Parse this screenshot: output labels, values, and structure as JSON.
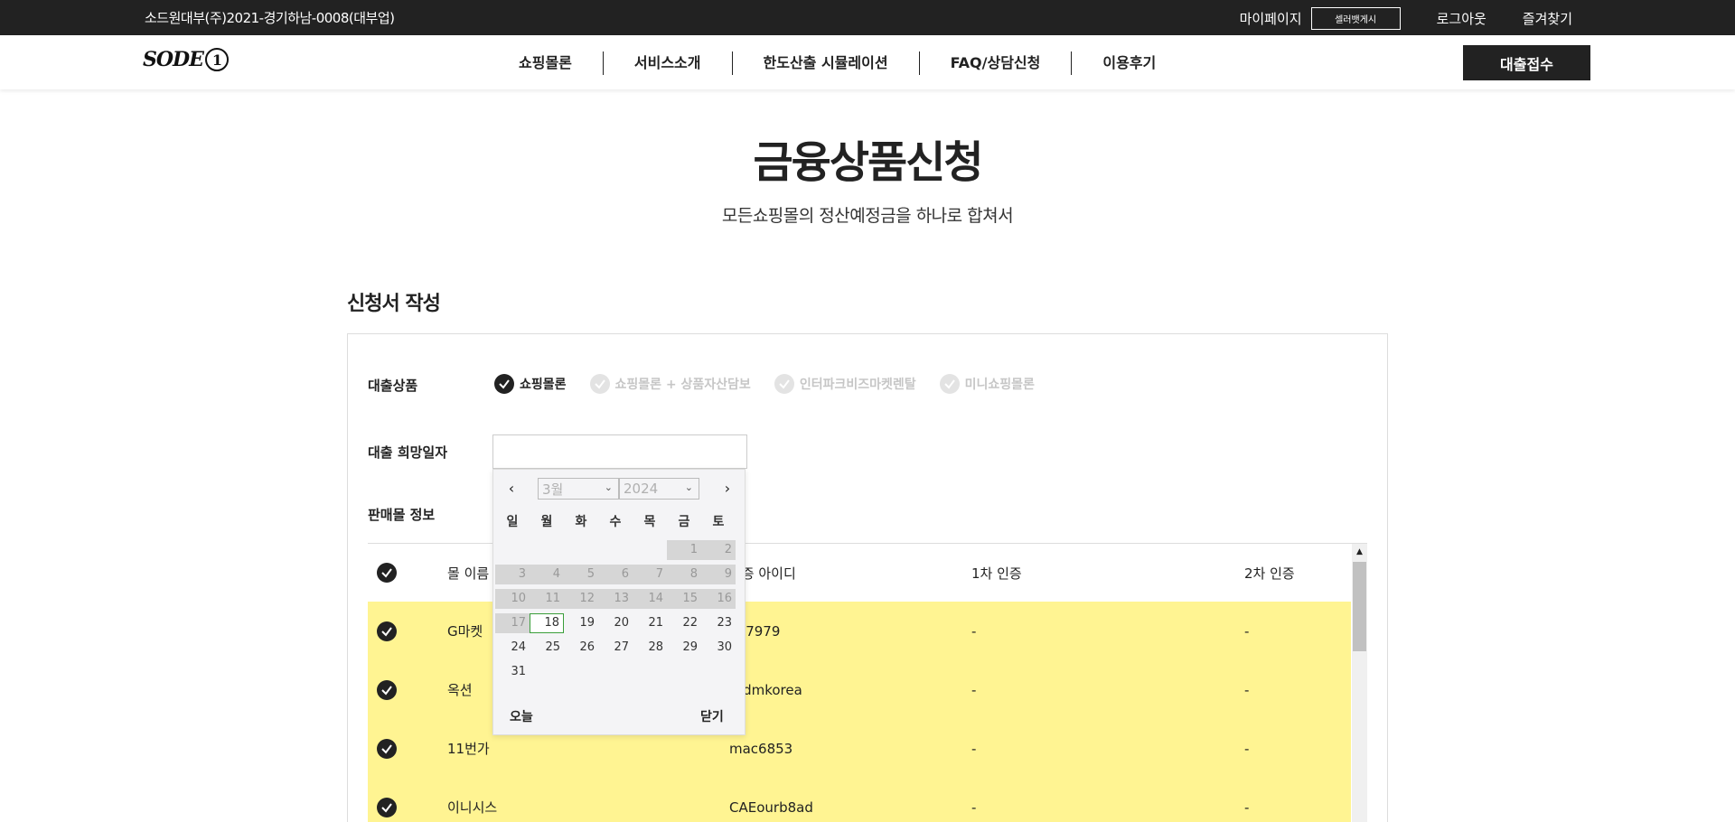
{
  "topbar": {
    "company": "소드원대부(주)2021-경기하남-0008(대부업)",
    "mypage": "마이페이지",
    "seller_button": "셀러뱃게시",
    "logout": "로그아웃",
    "bookmark": "즐겨찾기"
  },
  "header": {
    "logo_text": "SODE",
    "logo_num": "1",
    "nav": [
      "쇼핑몰론",
      "서비스소개",
      "한도산출 시뮬레이션",
      "FAQ/상담신청",
      "이용후기"
    ],
    "apply_button": "대출접수"
  },
  "hero": {
    "title": "금융상품신청",
    "subtitle": "모든쇼핑몰의 정산예정금을 하나로 합쳐서"
  },
  "form": {
    "section_title": "신청서 작성",
    "product_label": "대출상품",
    "products": [
      {
        "label": "쇼핑몰론",
        "checked": true
      },
      {
        "label": "쇼핑몰론 + 상품자산담보",
        "checked": false
      },
      {
        "label": "인터파크비즈마켓렌탈",
        "checked": false
      },
      {
        "label": "미니쇼핑몰론",
        "checked": false
      }
    ],
    "date_label": "대출 희망일자",
    "date_value": "",
    "mall_label": "판매몰 정보"
  },
  "datepicker": {
    "month": "3월",
    "year": "2024",
    "weekdays": [
      "일",
      "월",
      "화",
      "수",
      "목",
      "금",
      "토"
    ],
    "disabled_days": [
      1,
      2,
      3,
      4,
      5,
      6,
      7,
      8,
      9,
      10,
      11,
      12,
      13,
      14,
      15,
      16,
      17
    ],
    "today": 18,
    "first_weekday": 5,
    "days_in_month": 31,
    "today_button": "오늘",
    "close_button": "닫기"
  },
  "table": {
    "headers": [
      "몰 이름",
      "인증 아이디",
      "1차 인증",
      "2차 인증"
    ],
    "rows": [
      {
        "mall": "G마켓",
        "id": "nk7979",
        "auth1": "-",
        "auth2": "-"
      },
      {
        "mall": "옥션",
        "id": "ardmkorea",
        "auth1": "-",
        "auth2": "-"
      },
      {
        "mall": "11번가",
        "id": "mac6853",
        "auth1": "-",
        "auth2": "-"
      },
      {
        "mall": "이니시스",
        "id": "CAEourb8ad",
        "auth1": "-",
        "auth2": "-"
      }
    ]
  },
  "colors": {
    "dark": "#222222",
    "row_highlight": "#fff492",
    "today_border": "#3a9e3a"
  }
}
